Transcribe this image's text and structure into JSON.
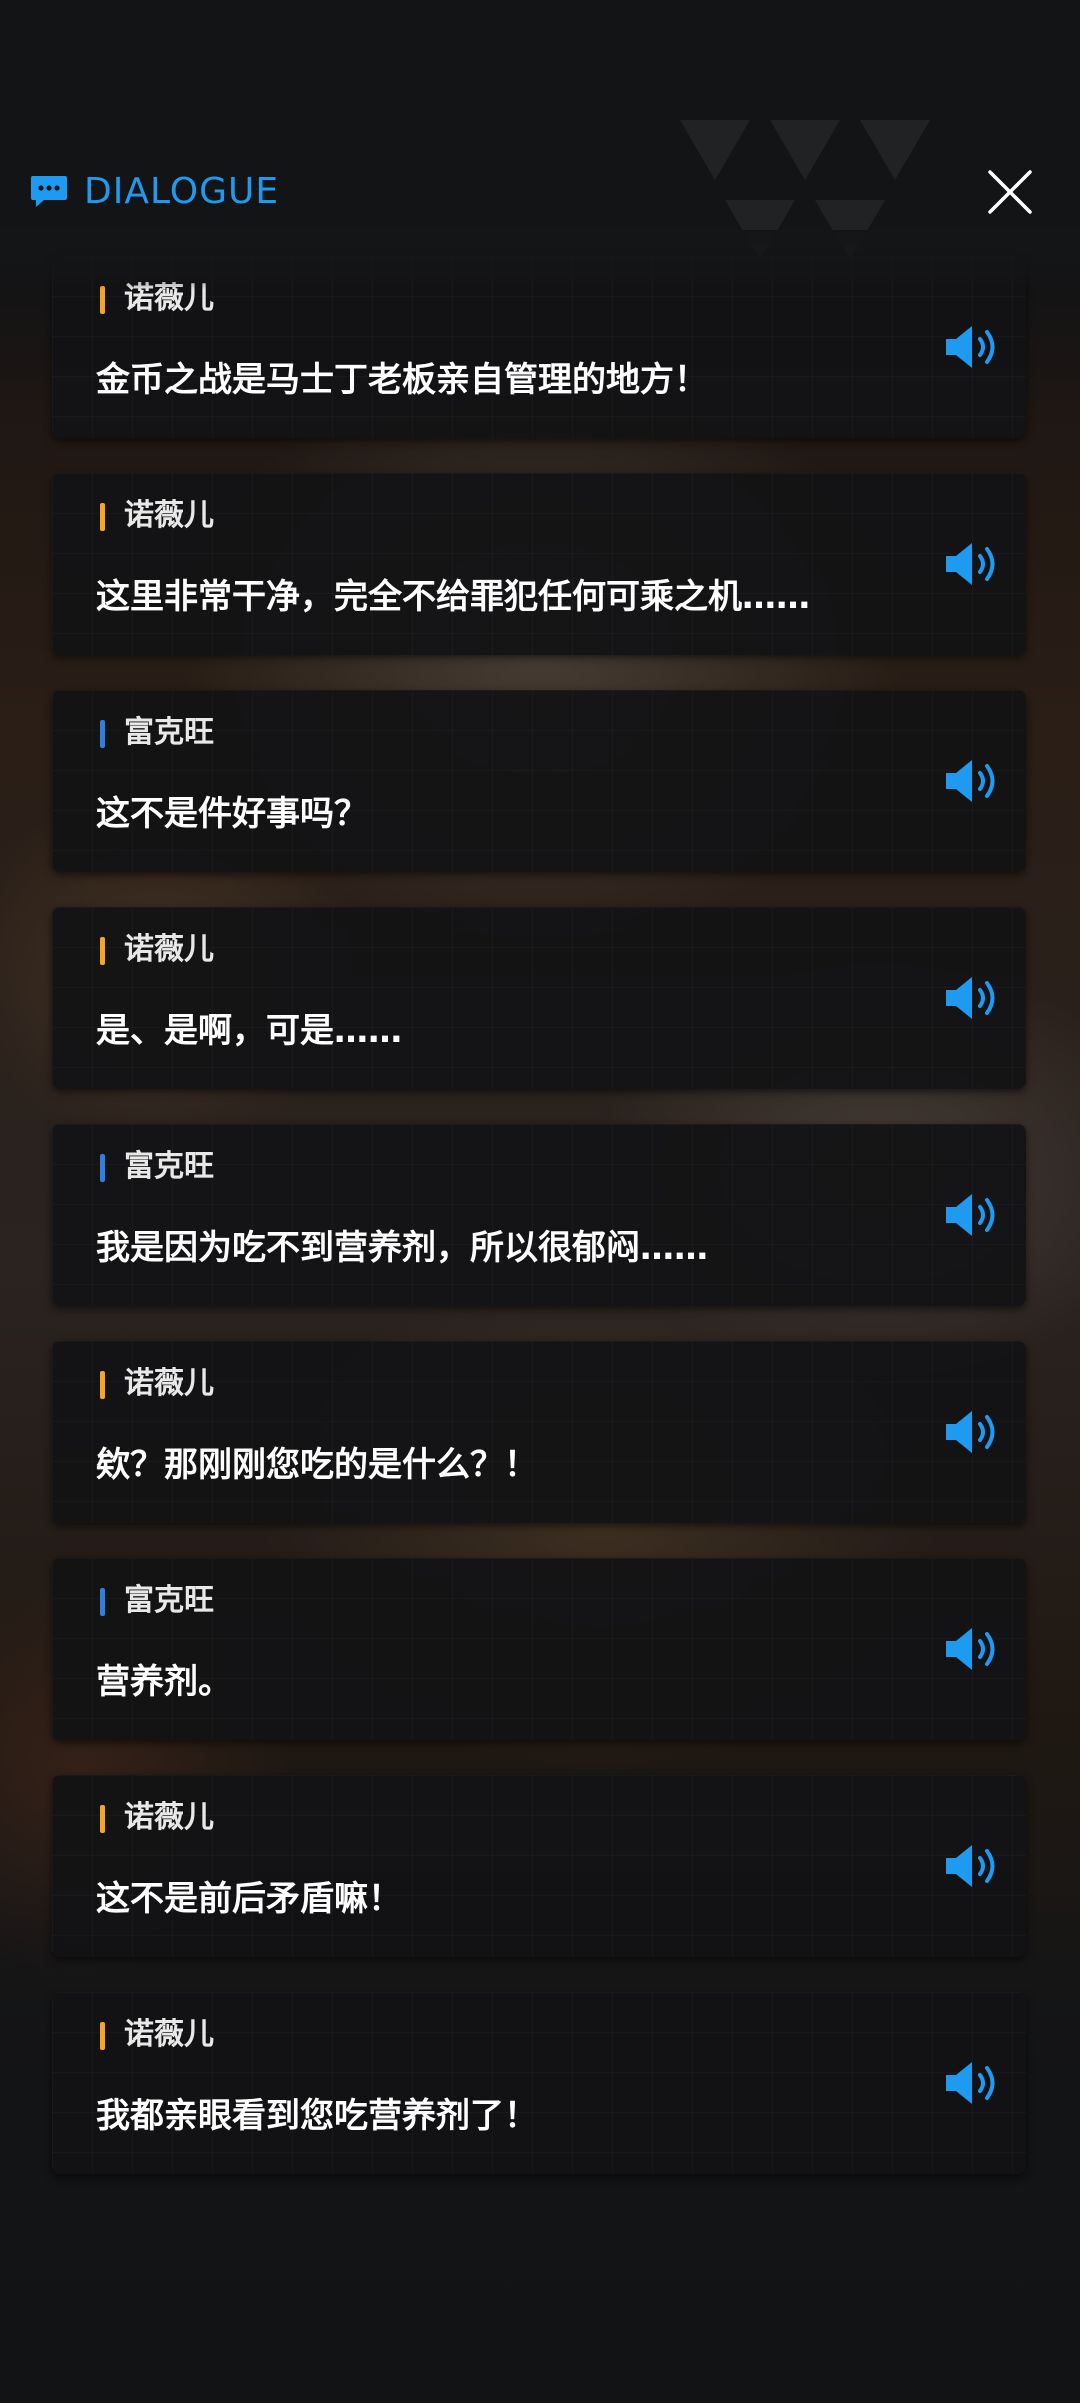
{
  "header": {
    "title": "DIALOGUE",
    "icon": "chat-bubble-icon",
    "close_icon": "close-icon"
  },
  "colors": {
    "accent": "#1e9bf0",
    "speaker_orange": "#f5a623",
    "speaker_blue": "#2f7fe0"
  },
  "dialogue": [
    {
      "speaker": "诺薇儿",
      "color": "#f5a623",
      "text": "金币之战是马士丁老板亲自管理的地方！"
    },
    {
      "speaker": "诺薇儿",
      "color": "#f5a623",
      "text": "这里非常干净，完全不给罪犯任何可乘之机……"
    },
    {
      "speaker": "富克旺",
      "color": "#2f7fe0",
      "text": "这不是件好事吗？"
    },
    {
      "speaker": "诺薇儿",
      "color": "#f5a623",
      "text": "是、是啊，可是……"
    },
    {
      "speaker": "富克旺",
      "color": "#2f7fe0",
      "text": "我是因为吃不到营养剂，所以很郁闷……"
    },
    {
      "speaker": "诺薇儿",
      "color": "#f5a623",
      "text": "欸？那刚刚您吃的是什么？！"
    },
    {
      "speaker": "富克旺",
      "color": "#2f7fe0",
      "text": "营养剂。"
    },
    {
      "speaker": "诺薇儿",
      "color": "#f5a623",
      "text": "这不是前后矛盾嘛！"
    },
    {
      "speaker": "诺薇儿",
      "color": "#f5a623",
      "text": "我都亲眼看到您吃营养剂了！"
    }
  ]
}
